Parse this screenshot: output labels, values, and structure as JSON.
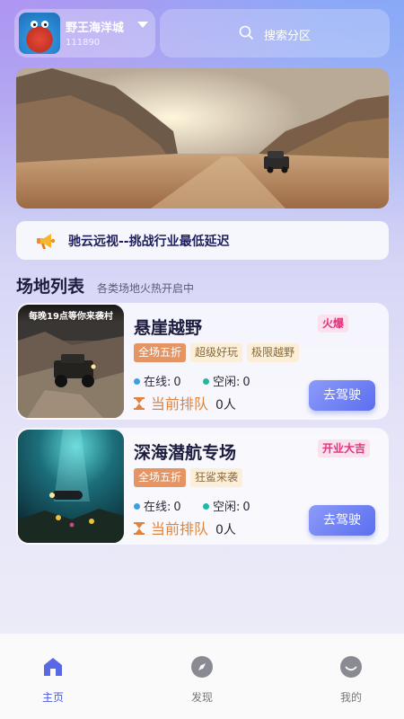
{
  "header": {
    "user_name": "野王海洋城",
    "user_id": "111890",
    "search_label": "搜索分区"
  },
  "notice": {
    "text": "驰云远视--挑战行业最低延迟"
  },
  "section": {
    "title": "场地列表",
    "subtitle": "各类场地火热开启中"
  },
  "venues": [
    {
      "thumb_caption": "每晚19点等你来袭村",
      "name": "悬崖越野",
      "badge": "火爆",
      "tags": [
        "全场五折",
        "超级好玩",
        "极限越野"
      ],
      "online_label": "在线:",
      "online_count": "0",
      "idle_label": "空闲:",
      "idle_count": "0",
      "queue_label": "当前排队",
      "queue_count": "0人",
      "button_label": "去驾驶"
    },
    {
      "thumb_caption": "",
      "name": "深海潜航专场",
      "badge": "开业大吉",
      "tags": [
        "全场五折",
        "狂鲨来袭"
      ],
      "online_label": "在线:",
      "online_count": "0",
      "idle_label": "空闲:",
      "idle_count": "0",
      "queue_label": "当前排队",
      "queue_count": "0人",
      "button_label": "去驾驶"
    }
  ],
  "nav": {
    "items": [
      {
        "label": "主页",
        "icon": "home-icon",
        "active": true
      },
      {
        "label": "发现",
        "icon": "compass-icon",
        "active": false
      },
      {
        "label": "我的",
        "icon": "smile-icon",
        "active": false
      }
    ]
  },
  "colors": {
    "accent": "#4b58d8",
    "badge_text": "#e0347d",
    "queue_text": "#e0843d",
    "tag_main": "#e59463"
  }
}
